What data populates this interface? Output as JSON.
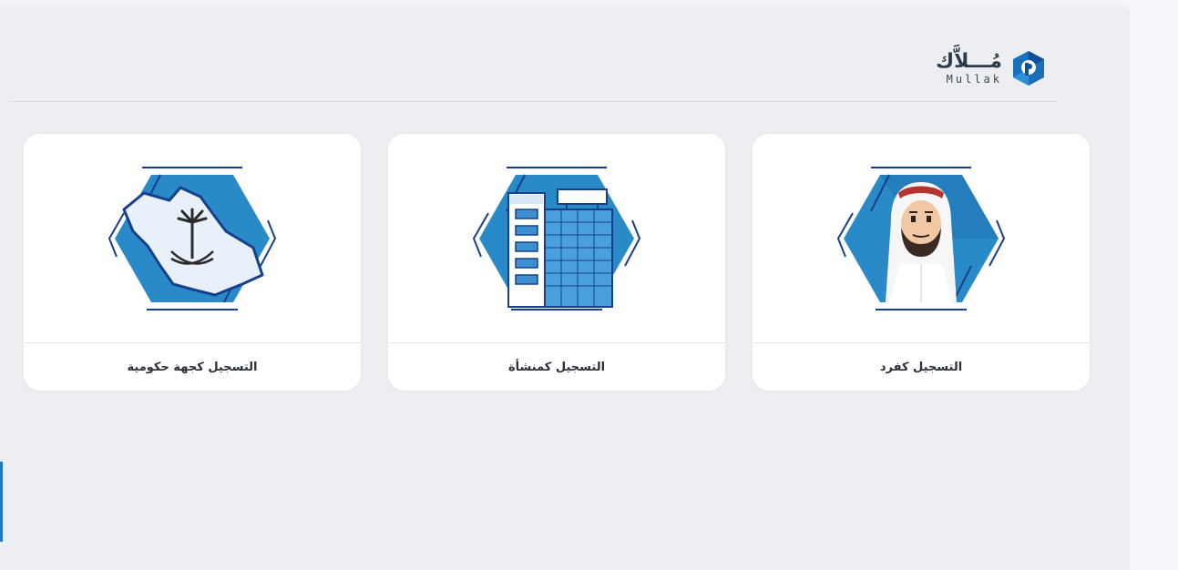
{
  "brand": {
    "name_ar": "مُـــلاَّك",
    "name_en": "Mullak",
    "icon": "mullak-logo-icon"
  },
  "cards": [
    {
      "label": "التسجيل كفرد",
      "icon": "individual-person-icon"
    },
    {
      "label": "التسجيل كمنشأة",
      "icon": "building-establishment-icon"
    },
    {
      "label": "التسجيل كجهة حكومية",
      "icon": "saudi-map-government-icon"
    }
  ],
  "colors": {
    "accent": "#1f77c9",
    "hex_fill": "#2e86c6",
    "hex_dark": "#173f8a",
    "background": "#eceef2",
    "card": "#ffffff"
  }
}
